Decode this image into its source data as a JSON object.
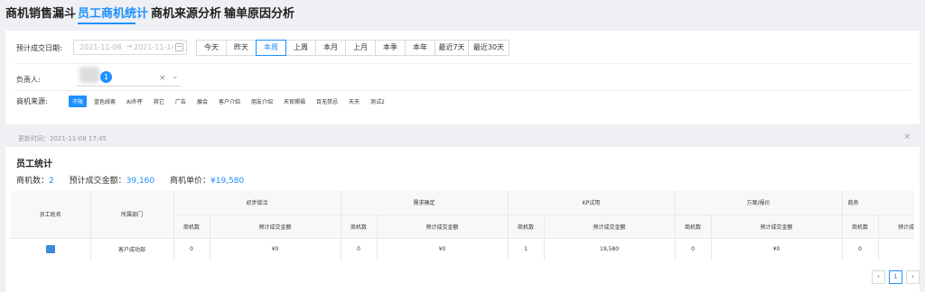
{
  "tabs": [
    "商机销售漏斗",
    "员工商机统计",
    "商机来源分析",
    "输单原因分析"
  ],
  "active_tab": 1,
  "filters": {
    "date_label": "预计成交日期:",
    "date_start": "2021-11-08",
    "date_end": "2021-11-14",
    "periods": [
      "今天",
      "昨天",
      "本周",
      "上周",
      "本月",
      "上月",
      "本季",
      "本年",
      "最近7天",
      "最近30天"
    ],
    "active_period": "本周",
    "owner_label": "负责人:",
    "owner_count": "1",
    "source_label": "商机来源:",
    "sources": [
      "不限",
      "蓝色线索",
      "AI外呼",
      "其它",
      "广告",
      "展会",
      "客户介绍",
      "朋友介绍",
      "天官赐福",
      "百无禁忌",
      "天天",
      "测试2"
    ],
    "active_source": "不限"
  },
  "update_bar": {
    "text": "更新时间：2021-11-08 17:45",
    "close": "×"
  },
  "stats": {
    "title": "员工统计",
    "summary": [
      {
        "label": "商机数：",
        "value": "2"
      },
      {
        "label": "预计成交金额：",
        "value": "39,160"
      },
      {
        "label": "商机单价：",
        "value": "¥19,580"
      }
    ]
  },
  "table": {
    "fixed_headers": [
      "员工姓名",
      "所属部门"
    ],
    "groups": [
      "初步接洽",
      "需求确定",
      "KP试用",
      "方案/报价",
      "商务"
    ],
    "sub_headers": [
      "商机数",
      "预计成交金额"
    ],
    "rows": [
      {
        "dept": "客户成功部",
        "cells": [
          "0",
          "¥0",
          "0",
          "¥0",
          "1",
          "19,580",
          "0",
          "¥0",
          "0",
          ""
        ]
      }
    ]
  },
  "pagination": {
    "prev": "‹",
    "current": "1",
    "next": "›"
  }
}
